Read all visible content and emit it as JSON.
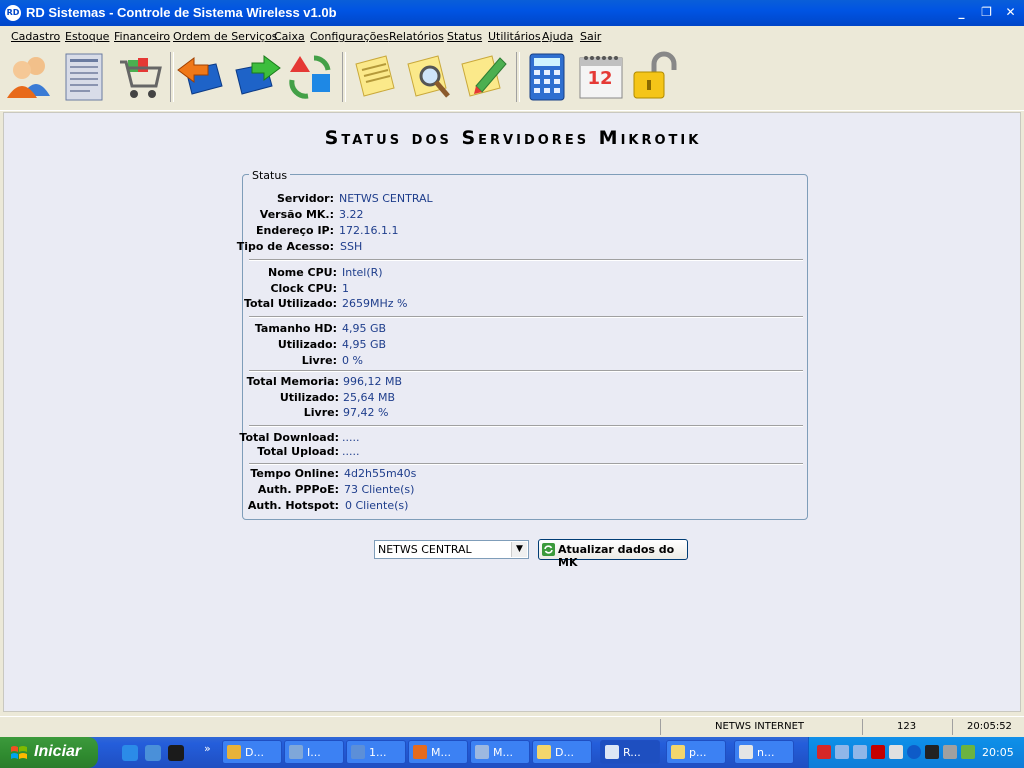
{
  "window": {
    "title": "RD Sistemas - Controle de Sistema Wireless v1.0b",
    "icon_label": "RD",
    "minimize_icon": "_",
    "restore_icon": "❐",
    "close_icon": "✕"
  },
  "menu": [
    "Cadastro",
    "Estoque",
    "Financeiro",
    "Ordem de Serviços",
    "Caixa",
    "Configurações",
    "Relatórios",
    "Status",
    "Utilitários",
    "Ajuda",
    "Sair"
  ],
  "toolbar": {
    "icons": [
      "clients-icon",
      "document-list-icon",
      "shopping-cart-icon",
      "book-back-icon",
      "book-forward-icon",
      "recycle-icon",
      "notes-icon",
      "search-notes-icon",
      "edit-notes-icon",
      "calculator-icon",
      "calendar-icon",
      "padlock-icon"
    ],
    "calendar_day": "12"
  },
  "page": {
    "title": "Status dos Servidores Mikrotik",
    "group_label": "Status"
  },
  "status": {
    "servidor": {
      "label": "Servidor:",
      "value": "NETWS CENTRAL"
    },
    "versao": {
      "label": "Versão MK.:",
      "value": "3.22"
    },
    "ip": {
      "label": "Endereço IP:",
      "value": "172.16.1.1"
    },
    "acesso": {
      "label": "Tipo de Acesso:",
      "value": "SSH"
    },
    "cpu_nome": {
      "label": "Nome CPU:",
      "value": "Intel(R)"
    },
    "cpu_clock": {
      "label": "Clock CPU:",
      "value": "1"
    },
    "cpu_total": {
      "label": "Total Utilizado:",
      "value": "2659MHz %"
    },
    "hd_tamanho": {
      "label": "Tamanho HD:",
      "value": "4,95 GB"
    },
    "hd_utilizado": {
      "label": "Utilizado:",
      "value": "4,95 GB"
    },
    "hd_livre": {
      "label": "Livre:",
      "value": "0 %"
    },
    "mem_total": {
      "label": "Total Memoria:",
      "value": "996,12 MB"
    },
    "mem_utilizado": {
      "label": "Utilizado:",
      "value": "25,64 MB"
    },
    "mem_livre": {
      "label": "Livre:",
      "value": "97,42 %"
    },
    "download": {
      "label": "Total Download:",
      "value": "....."
    },
    "upload": {
      "label": "Total Upload:",
      "value": "....."
    },
    "tempo": {
      "label": "Tempo Online:",
      "value": "4d2h55m40s"
    },
    "pppoe": {
      "label": "Auth. PPPoE:",
      "value": "73 Cliente(s)"
    },
    "hotspot": {
      "label": "Auth. Hotspot:",
      "value": "0 Cliente(s)"
    }
  },
  "controls": {
    "server_select": "NETWS CENTRAL",
    "update_button": "Atualizar dados do MK"
  },
  "statusbar": {
    "company": "NETWS INTERNET",
    "user": "123",
    "time": "20:05:52"
  },
  "taskbar": {
    "start": "Iniciar",
    "more": "»",
    "tasks": [
      "D...",
      "I...",
      "1...",
      "M...",
      "M...",
      "D...",
      "R...",
      "p...",
      "n..."
    ],
    "clock": "20:05"
  },
  "colors": {
    "title_blue": "#0054E3",
    "value_blue": "#1F3E8C",
    "content_bg": "#EAEBF4",
    "start_green": "#2F8A2F"
  }
}
